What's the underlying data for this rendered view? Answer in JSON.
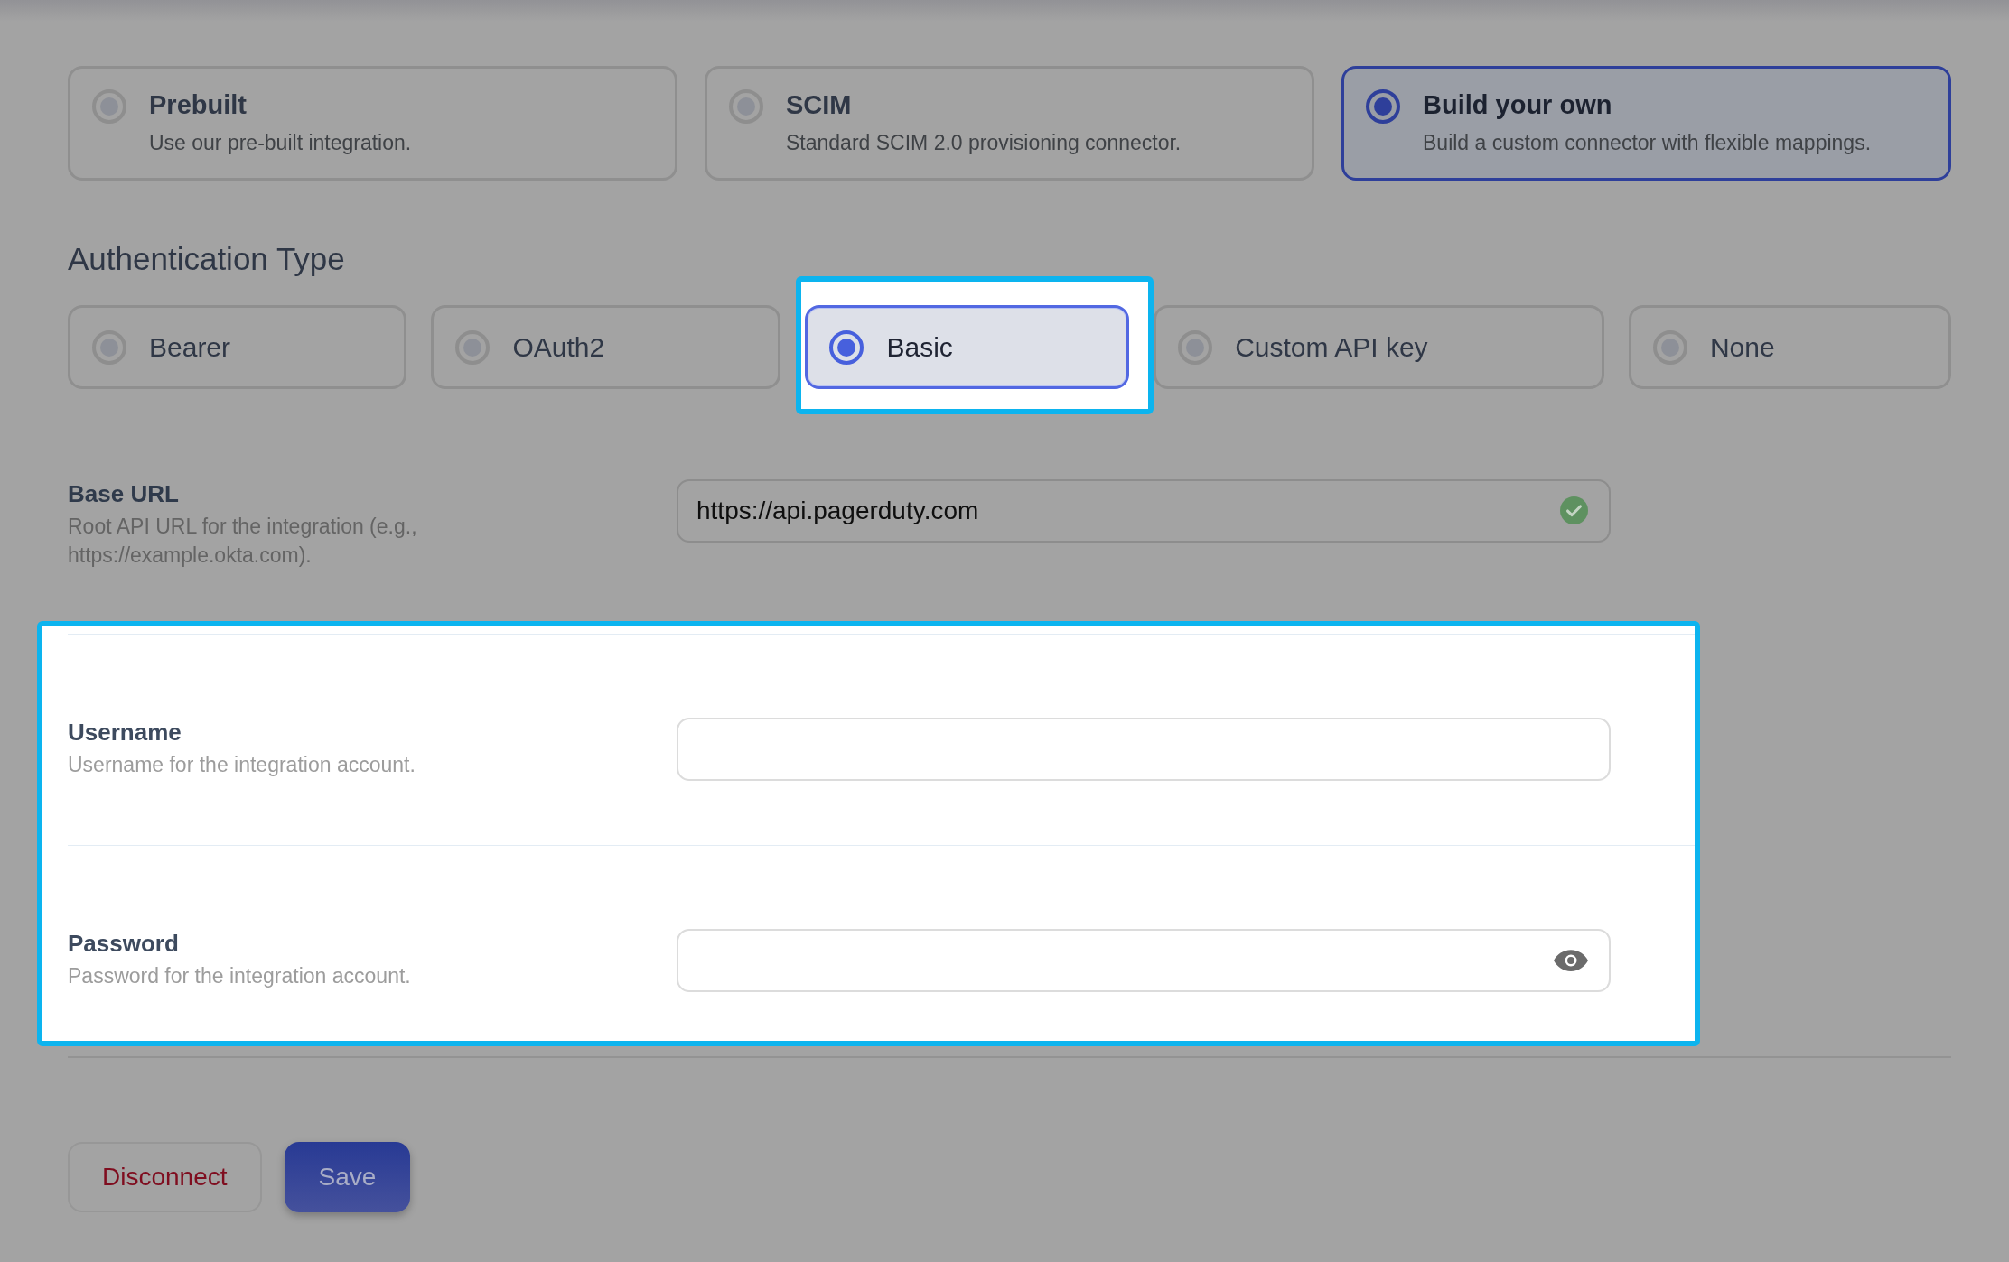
{
  "integration_types": [
    {
      "title": "Prebuilt",
      "description": "Use our pre-built integration.",
      "selected": false
    },
    {
      "title": "SCIM",
      "description": "Standard SCIM 2.0 provisioning connector.",
      "selected": false
    },
    {
      "title": "Build your own",
      "description": "Build a custom connector with flexible mappings.",
      "selected": true
    }
  ],
  "authentication": {
    "heading": "Authentication Type",
    "options": [
      {
        "label": "Bearer",
        "selected": false,
        "highlighted": false
      },
      {
        "label": "OAuth2",
        "selected": false,
        "highlighted": false
      },
      {
        "label": "Basic",
        "selected": true,
        "highlighted": true
      },
      {
        "label": "Custom API key",
        "selected": false,
        "highlighted": false
      },
      {
        "label": "None",
        "selected": false,
        "highlighted": false
      }
    ]
  },
  "base_url": {
    "label": "Base URL",
    "description": "Root API URL for the integration (e.g., https://example.okta.com).",
    "value": "https://api.pagerduty.com",
    "valid": true
  },
  "credentials": {
    "highlighted": true,
    "fields": [
      {
        "label": "Username",
        "description": "Username for the integration account.",
        "kind": "text"
      },
      {
        "label": "Password",
        "description": "Password for the integration account.",
        "kind": "password"
      }
    ]
  },
  "buttons": [
    {
      "label": "Disconnect",
      "kind": "danger"
    },
    {
      "label": "Save",
      "kind": "primary"
    }
  ]
}
